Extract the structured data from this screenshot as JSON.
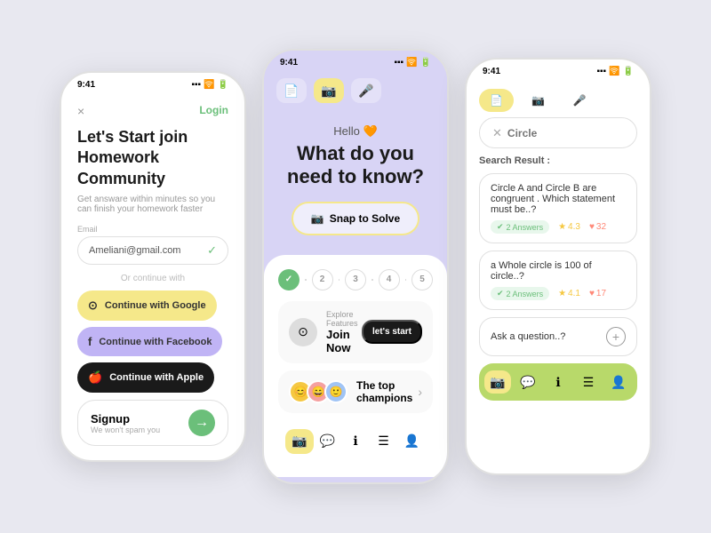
{
  "phone1": {
    "status_time": "9:41",
    "login_label": "Login",
    "close_label": "×",
    "headline": "Let's Start join Homework ",
    "headline_bold": "Community",
    "subtext": "Get answare within minutes so you can finish your homework faster",
    "email_label": "Email",
    "email_value": "Ameliani@gmail.com",
    "divider": "Or continue with",
    "google_btn": "Continue with Google",
    "facebook_btn": "Continue with Facebook",
    "apple_btn": "Continue with Apple",
    "signup_title": "Signup",
    "signup_sub": "We won't spam you"
  },
  "phone2": {
    "status_time": "9:41",
    "hello": "Hello 🧡",
    "hero_title": "What do you need to know?",
    "snap_btn": "Snap to Solve",
    "explore_label": "Explore Features",
    "join_now": "Join Now",
    "lets_start": "let's start",
    "champions": "The top champions",
    "steps": [
      "2",
      "3",
      "4",
      "5"
    ]
  },
  "phone3": {
    "status_time": "9:41",
    "search_placeholder": "Circle",
    "result_label": "Search Result :",
    "results": [
      {
        "title": "Circle A and Circle B are congruent . Which statement must be..?",
        "answers": "2 Answers",
        "rating": "4.3",
        "likes": "32"
      },
      {
        "title": "a Whole circle is 100 of circle..?",
        "answers": "2 Answers",
        "rating": "4.1",
        "likes": "17"
      }
    ],
    "ask_label": "Ask a question..?"
  },
  "colors": {
    "green": "#6bbf7a",
    "yellow": "#f5e88a",
    "purple": "#c0b4f5",
    "purple_bg": "#d8d4f5",
    "dark": "#1a1a1a"
  }
}
